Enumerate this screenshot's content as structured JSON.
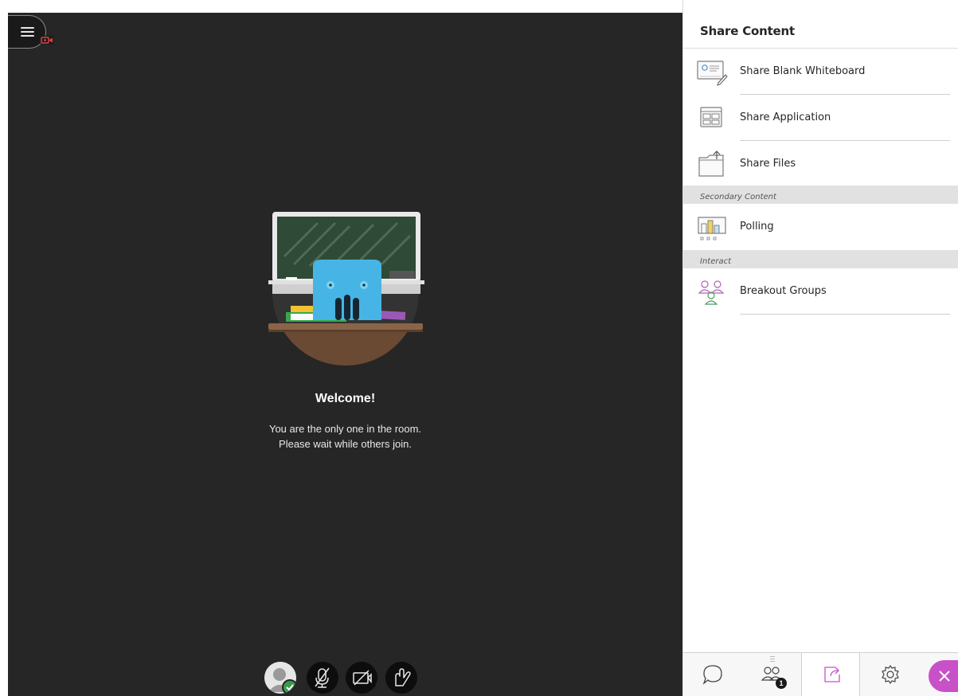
{
  "stage": {
    "menu_icon": "hamburger-menu-icon",
    "recording_icon": "recording-camera-icon",
    "welcome_title": "Welcome!",
    "welcome_line1": "You are the only one in the room.",
    "welcome_line2": "Please wait while others join.",
    "controls": [
      {
        "name": "avatar",
        "icon": "avatar-icon",
        "status": "available"
      },
      {
        "name": "microphone",
        "icon": "mic-muted-icon"
      },
      {
        "name": "camera",
        "icon": "camera-off-icon"
      },
      {
        "name": "raise-hand",
        "icon": "hand-icon"
      }
    ]
  },
  "panel": {
    "title": "Share Content",
    "items": [
      {
        "label": "Share Blank Whiteboard",
        "icon": "whiteboard-icon"
      },
      {
        "label": "Share Application",
        "icon": "application-icon"
      },
      {
        "label": "Share Files",
        "icon": "files-icon"
      }
    ],
    "secondary_heading": "Secondary Content",
    "secondary_items": [
      {
        "label": "Polling",
        "icon": "polling-icon"
      }
    ],
    "interact_heading": "Interact",
    "interact_items": [
      {
        "label": "Breakout Groups",
        "icon": "breakout-groups-icon"
      }
    ]
  },
  "tabs": {
    "chat": "chat-icon",
    "attendees": "attendees-icon",
    "attendees_count": "1",
    "share": "share-content-icon",
    "settings": "gear-icon",
    "close": "close-icon",
    "accent": "#c850c8"
  }
}
